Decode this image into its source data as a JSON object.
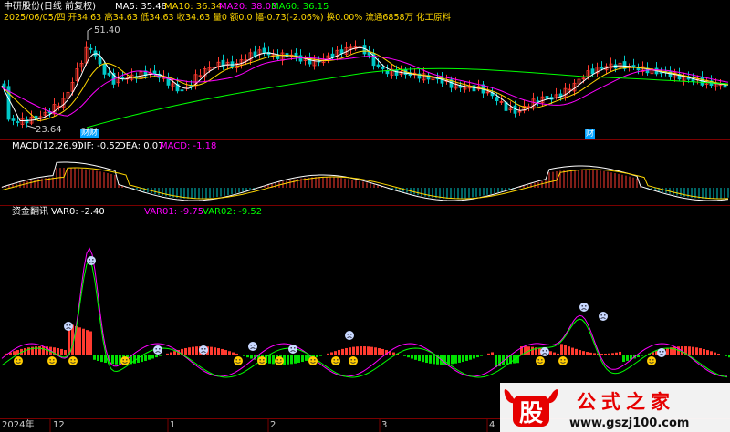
{
  "header": {
    "stock_title": "中研股份(日线 前复权)",
    "ma5": "MA5: 35.48",
    "ma10": "MA10: 36.34",
    "ma20": "MA20: 38.03",
    "ma60": "MA60: 36.15",
    "quote_line": "2025/06/05/四 开34.63 高34.63 低34.63 收34.63 量0 额0.0 幅-0.73(-2.06%) 换0.00% 流通6858万 化工原料"
  },
  "price_panel": {
    "high_label": "51.40",
    "low_label": "23.64",
    "badge_left": "财",
    "badge_left2": "财",
    "badge_right": "财"
  },
  "macd_panel": {
    "title": "MACD(12,26,9)",
    "dif": "DIF: -0.52",
    "dea": "DEA: 0.07",
    "macd": "MACD: -1.18"
  },
  "fund_panel": {
    "title": "资金翻讯",
    "var0": "VAR0: -2.40",
    "var01": "VAR01: -9.75",
    "var02": "VAR02: -9.52"
  },
  "time_axis": {
    "labels": [
      "2024年",
      "12",
      "1",
      "2",
      "3",
      "4"
    ]
  },
  "watermark": {
    "mark": "股",
    "site_name": "公式之家",
    "url": "www.gszj100.com"
  },
  "colors": {
    "bg": "#000000",
    "up": "#ff3b30",
    "down": "#00c8c8",
    "ma5": "#ffffff",
    "ma10": "#ffd700",
    "ma20": "#ff00ff",
    "ma60": "#00ff00",
    "grid": "#7a0000"
  }
}
